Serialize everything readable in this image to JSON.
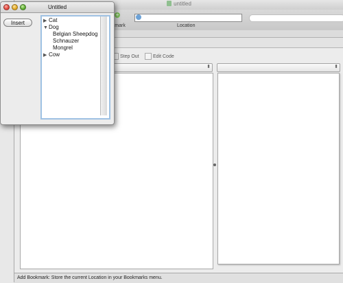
{
  "back_window": {
    "title": "untitled",
    "toolbar": {
      "bookmark_label": "ookmark",
      "location_label": "Location"
    },
    "sub_toolbar": {
      "step_out": "Step Out",
      "edit_code": "Edit Code"
    },
    "status": "Add Bookmark: Store the current Location in your Bookmarks menu."
  },
  "palette": {
    "title": "Untitled",
    "insert_button": "Insert",
    "tree": [
      {
        "label": "Cat",
        "disclosure": "collapsed"
      },
      {
        "label": "Dog",
        "disclosure": "expanded"
      },
      {
        "label": "Belgian Sheepdog",
        "disclosure": "none"
      },
      {
        "label": "Schnauzer",
        "disclosure": "none"
      },
      {
        "label": "Mongrel",
        "disclosure": "none"
      },
      {
        "label": "Cow",
        "disclosure": "collapsed"
      }
    ]
  },
  "icons": {
    "disclosure_collapsed": "▶",
    "disclosure_expanded": "▼",
    "select_arrow": "⬍"
  },
  "colors": {
    "selection_border": "#9ec1e3",
    "close": "#e0443a",
    "minimize": "#e0a520",
    "zoom": "#5aaa2d"
  }
}
